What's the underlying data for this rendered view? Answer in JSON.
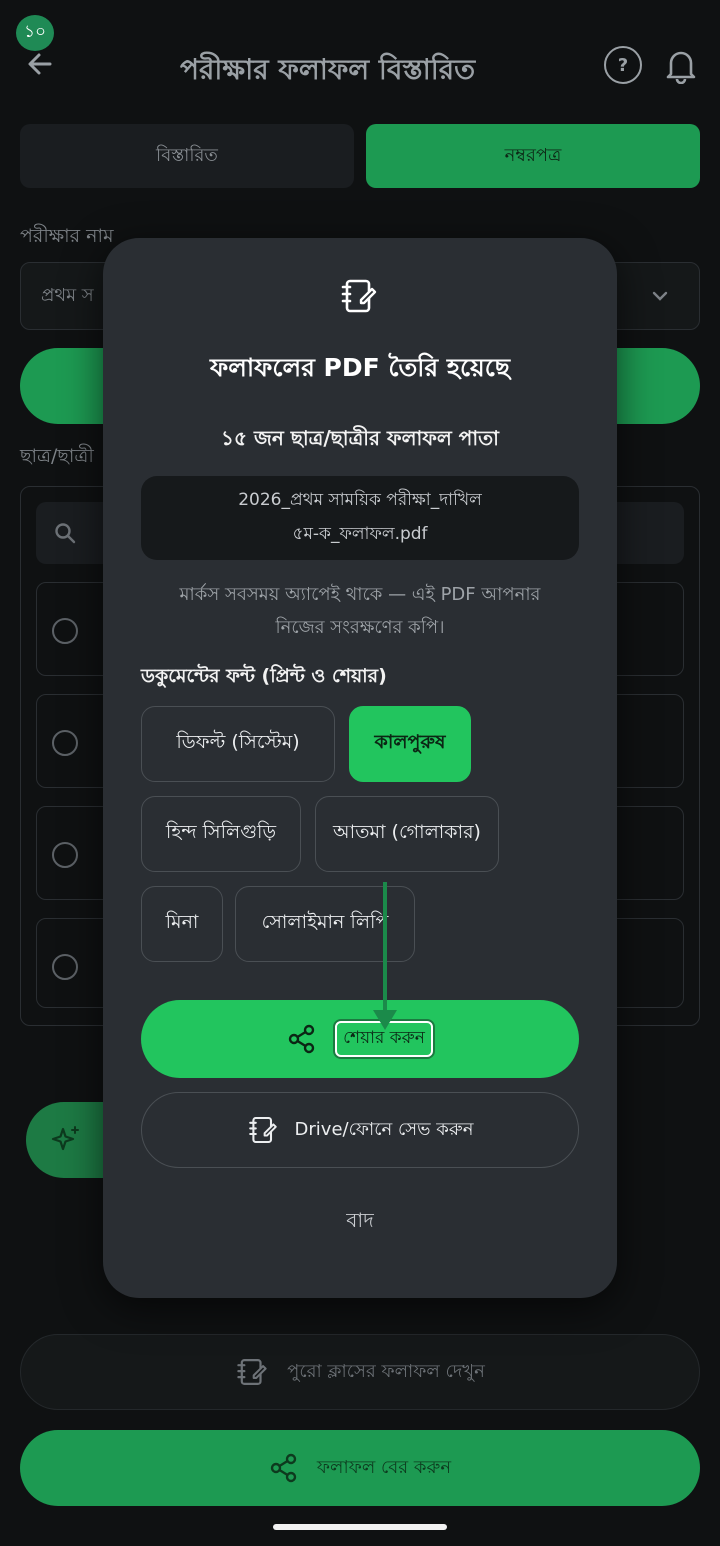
{
  "step_badge": "১০",
  "header": {
    "title": "পরীক্ষার ফলাফল বিস্তারিত",
    "help": "?"
  },
  "tabs": [
    {
      "label": "বিস্তারিত"
    },
    {
      "label": "নম্বরপত্র"
    }
  ],
  "exam": {
    "label": "পরীক্ষার নাম",
    "value": "প্রথম স"
  },
  "students": {
    "label": "ছাত্র/ছাত্রী"
  },
  "bottom": {
    "view_class_label": "পুরো ক্লাসের ফলাফল দেখুন",
    "export_label": "ফলাফল বের করুন"
  },
  "modal": {
    "title": "ফলাফলের PDF তৈরি হয়েছে",
    "subtitle": "১৫ জন ছাত্র/ছাত্রীর ফলাফল পাতা",
    "file_name_line1": "2026_প্রথম সাময়িক পরীক্ষা_দাখিল",
    "file_name_line2": "৫ম-ক_ফলাফল.pdf",
    "note_line1": "মার্কস সবসময় অ্যাপেই থাকে — এই PDF আপনার",
    "note_line2": "নিজের সংরক্ষণের কপি।",
    "font_heading": "ডকুমেন্টের ফন্ট (প্রিন্ট ও শেয়ার)",
    "fonts": [
      {
        "label": "ডিফল্ট (সিস্টেম)",
        "selected": false
      },
      {
        "label": "কালপুরুষ",
        "selected": true
      },
      {
        "label": "হিন্দ সিলিগুড়ি",
        "selected": false
      },
      {
        "label": "আতমা (গোলাকার)",
        "selected": false
      },
      {
        "label": "মিনা",
        "selected": false
      },
      {
        "label": "সোলাইমান লিপি",
        "selected": false
      }
    ],
    "share_label": "শেয়ার করুন",
    "save_label": "Drive/ফোনে সেভ করুন",
    "cancel_label": "বাদ"
  },
  "colors": {
    "accent": "#22c55e",
    "modal_bg": "#2a2e33",
    "page_bg": "#0f1112"
  }
}
